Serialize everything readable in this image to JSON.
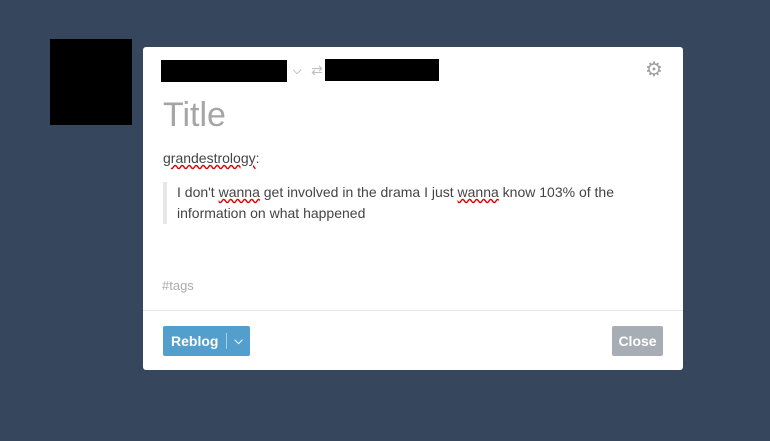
{
  "modal": {
    "title_placeholder": "Title",
    "source_name": "grandestrology",
    "source_suffix": ":",
    "quote_parts": [
      "I don't ",
      "wanna",
      " get involved in the drama I just ",
      "wanna",
      " know 103% of the information on what happened"
    ],
    "tags_placeholder": "#tags",
    "reblog_label": "Reblog",
    "close_label": "Close"
  },
  "icons": {
    "blog_selector_chevron": "chevron-down-icon",
    "reblog_arrows": "reblog-icon",
    "settings": "gear-icon",
    "reblog_dropdown": "chevron-down-icon"
  },
  "colors": {
    "background": "#36465d",
    "reblog_button": "#529ecc",
    "close_button": "#a7adb4"
  }
}
